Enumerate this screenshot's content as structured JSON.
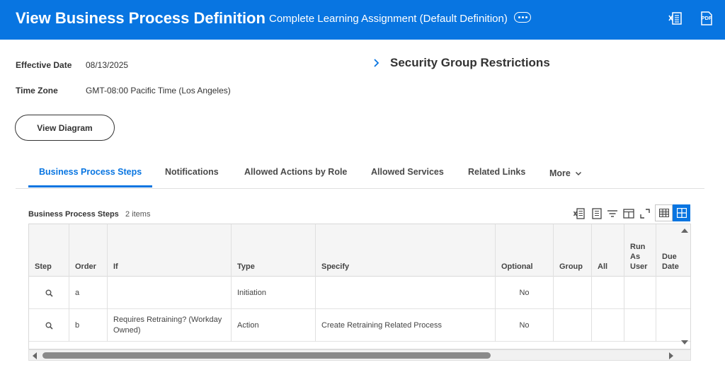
{
  "header": {
    "title": "View Business Process Definition",
    "subtitle": "Complete Learning Assignment (Default Definition)",
    "icons": [
      "excel-export-icon",
      "pdf-export-icon"
    ],
    "pdf_label": "PDF"
  },
  "fields": {
    "effective_date_label": "Effective Date",
    "effective_date_value": "08/13/2025",
    "time_zone_label": "Time Zone",
    "time_zone_value": "GMT-08:00 Pacific Time (Los Angeles)"
  },
  "view_diagram_label": "View Diagram",
  "security_group_title": "Security Group Restrictions",
  "tabs": [
    {
      "label": "Business Process Steps",
      "active": true
    },
    {
      "label": "Notifications",
      "active": false
    },
    {
      "label": "Allowed Actions by Role",
      "active": false
    },
    {
      "label": "Allowed Services",
      "active": false
    },
    {
      "label": "Related Links",
      "active": false
    },
    {
      "label": "More",
      "active": false
    }
  ],
  "grid": {
    "title": "Business Process Steps",
    "count": "2 items",
    "columns": [
      "Step",
      "Order",
      "If",
      "Type",
      "Specify",
      "Optional",
      "Group",
      "All",
      "Run As User",
      "Due Date"
    ],
    "rows": [
      {
        "order": "a",
        "if": "",
        "type": "Initiation",
        "specify": "",
        "optional": "No"
      },
      {
        "order": "b",
        "if": "Requires Retraining? (Workday Owned)",
        "type": "Action",
        "specify": "Create Retraining Related Process",
        "optional": "No"
      }
    ]
  },
  "colors": {
    "header_bg": "#0875e1",
    "accent": "#0875e1",
    "text": "#333333"
  }
}
